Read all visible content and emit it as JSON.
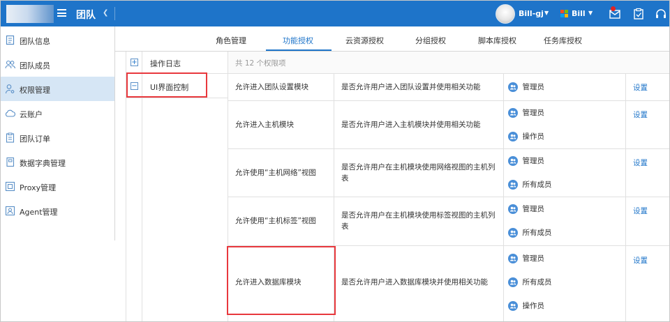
{
  "header": {
    "team_title": "团队",
    "user_name": "Bill-gj",
    "account_name": "Bill",
    "colors": {
      "bar": "#1e74c9",
      "notification_dot": "#e02424"
    }
  },
  "sidebar": {
    "items": [
      {
        "label": "团队信息",
        "icon": "document-icon"
      },
      {
        "label": "团队成员",
        "icon": "users-icon"
      },
      {
        "label": "权限管理",
        "icon": "user-key-icon",
        "active": true
      },
      {
        "label": "云账户",
        "icon": "cloud-icon"
      },
      {
        "label": "团队订单",
        "icon": "clipboard-icon"
      },
      {
        "label": "数据字典管理",
        "icon": "book-icon"
      },
      {
        "label": "Proxy管理",
        "icon": "proxy-icon"
      },
      {
        "label": "Agent管理",
        "icon": "agent-icon"
      }
    ]
  },
  "tabs": [
    {
      "label": "角色管理"
    },
    {
      "label": "功能授权",
      "active": true
    },
    {
      "label": "云资源授权"
    },
    {
      "label": "分组授权"
    },
    {
      "label": "脚本库授权"
    },
    {
      "label": "任务库授权"
    }
  ],
  "categories": [
    {
      "label": "操作日志",
      "expander": "+"
    },
    {
      "label": "UI界面控制",
      "expander": "−"
    }
  ],
  "permissions": {
    "count_label": "共 12 个权限项",
    "action_label": "设置",
    "rows": [
      {
        "name": "允许进入团队设置模块",
        "desc": "是否允许用户进入团队设置并使用相关功能",
        "roles": [
          "管理员"
        ]
      },
      {
        "name": "允许进入主机模块",
        "desc": "是否允许用户进入主机模块并使用相关功能",
        "roles": [
          "管理员",
          "操作员"
        ]
      },
      {
        "name": "允许使用“主机网络”视图",
        "desc": "是否允许用户在主机模块使用网络视图的主机列表",
        "roles": [
          "管理员",
          "所有成员"
        ]
      },
      {
        "name": "允许使用“主机标签”视图",
        "desc": "是否允许用户在主机模块使用标签视图的主机列表",
        "roles": [
          "管理员",
          "所有成员"
        ]
      },
      {
        "name": "允许进入数据库模块",
        "desc": "是否允许用户进入数据库模块并使用相关功能",
        "roles": [
          "管理员",
          "所有成员",
          "操作员"
        ]
      }
    ]
  }
}
